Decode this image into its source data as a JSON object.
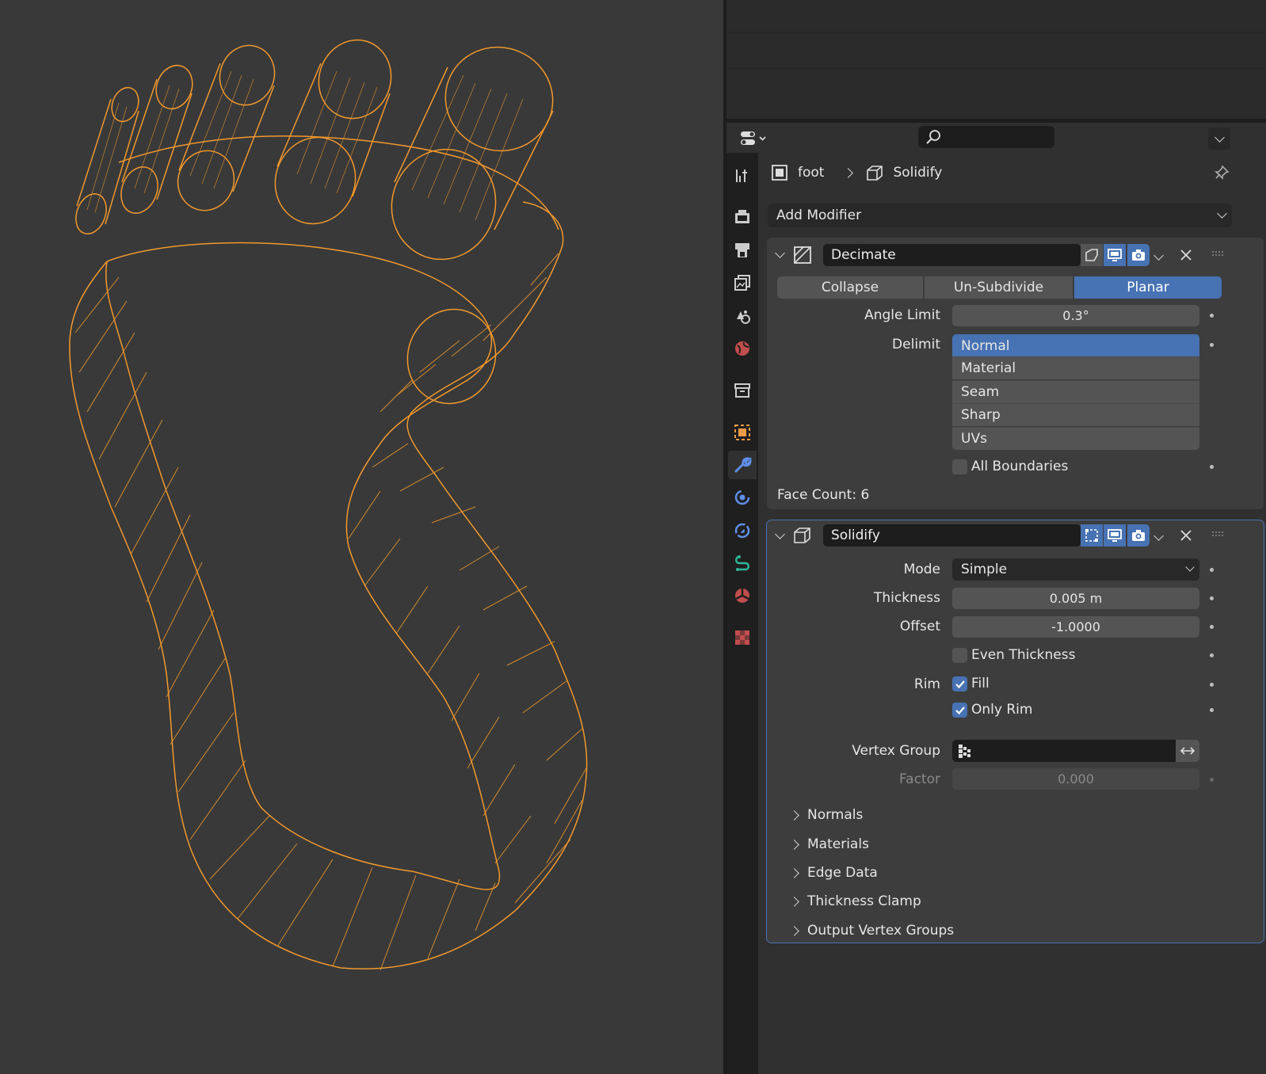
{
  "breadcrumb": {
    "object": "foot",
    "modifier": "Solidify"
  },
  "add_modifier_label": "Add Modifier",
  "decimate": {
    "name": "Decimate",
    "modes": [
      "Collapse",
      "Un-Subdivide",
      "Planar"
    ],
    "active_mode": "Planar",
    "angle_limit_label": "Angle Limit",
    "angle_limit_value": "0.3°",
    "delimit_label": "Delimit",
    "delimit_options": [
      "Normal",
      "Material",
      "Seam",
      "Sharp",
      "UVs"
    ],
    "delimit_selected": "Normal",
    "all_boundaries_label": "All Boundaries",
    "face_count": "Face Count: 6"
  },
  "solidify": {
    "name": "Solidify",
    "mode_label": "Mode",
    "mode_value": "Simple",
    "thickness_label": "Thickness",
    "thickness_value": "0.005 m",
    "offset_label": "Offset",
    "offset_value": "-1.0000",
    "even_thickness_label": "Even Thickness",
    "rim_label": "Rim",
    "fill_label": "Fill",
    "only_rim_label": "Only Rim",
    "vertex_group_label": "Vertex Group",
    "factor_label": "Factor",
    "factor_value": "0.000",
    "subpanels": [
      "Normals",
      "Materials",
      "Edge Data",
      "Thickness Clamp",
      "Output Vertex Groups"
    ]
  },
  "colors": {
    "accent": "#4772b3",
    "wire": "#f0982d",
    "viewport_bg": "#393939"
  }
}
